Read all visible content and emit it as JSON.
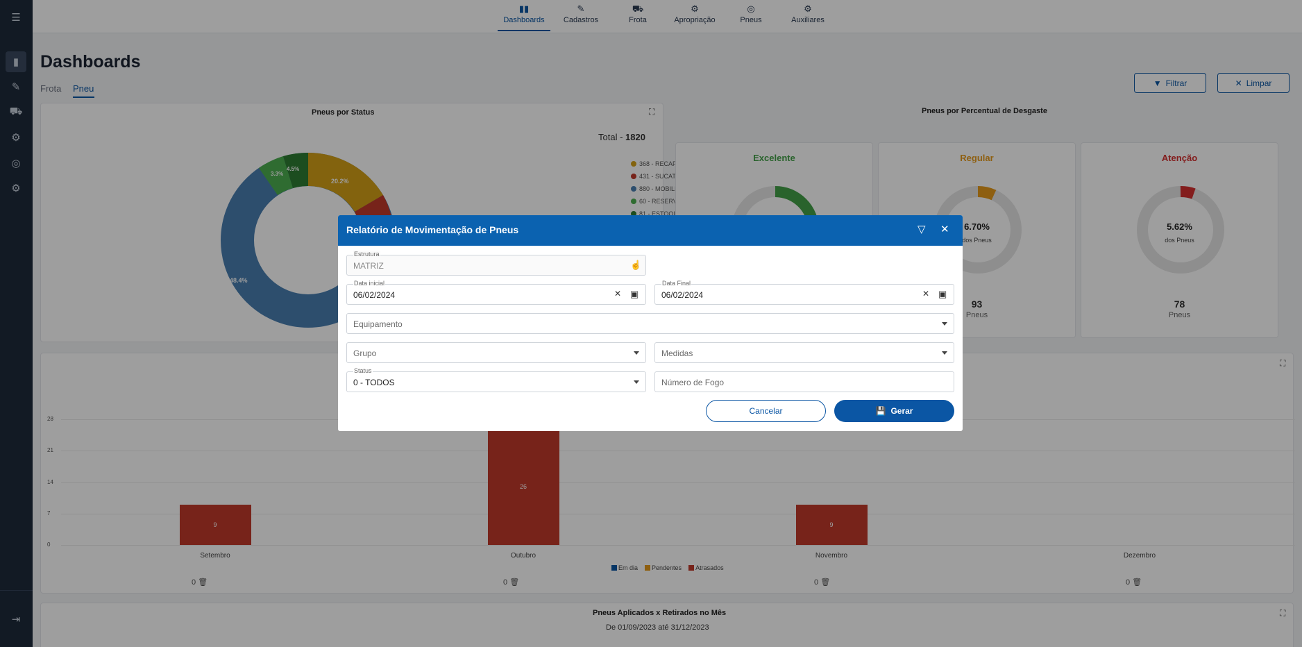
{
  "nav": {
    "items": [
      {
        "label": "Dashboards",
        "icon": "bar-chart-icon",
        "glyph": "▮▮"
      },
      {
        "label": "Cadastros",
        "icon": "pencil-icon",
        "glyph": "✎"
      },
      {
        "label": "Frota",
        "icon": "truck-icon",
        "glyph": "⛟"
      },
      {
        "label": "Apropriação",
        "icon": "gear-tool-icon",
        "glyph": "⚙"
      },
      {
        "label": "Pneus",
        "icon": "tire-icon",
        "glyph": "◎"
      },
      {
        "label": "Auxiliares",
        "icon": "gear-icon",
        "glyph": "⚙"
      }
    ],
    "active": "Dashboards"
  },
  "page": {
    "title": "Dashboards",
    "tabs": [
      "Frota",
      "Pneu"
    ],
    "active_tab": "Pneu",
    "filter_label": "Filtrar",
    "clear_label": "Limpar"
  },
  "status_card": {
    "title": "Pneus por Status",
    "total_label": "Total - ",
    "total_value": "1820",
    "legend": [
      {
        "label": "368 - RECAPAGEM",
        "color": "#d4a017"
      },
      {
        "label": "431 - SUCATEADO",
        "color": "#c0392b"
      },
      {
        "label": "880 - MOBILIZADO",
        "color": "#4a7fb0"
      },
      {
        "label": "60 - RESERVA",
        "color": "#4caf50"
      },
      {
        "label": "81 - ESTOQUE",
        "color": "#2e7d32"
      }
    ],
    "slice_labels": [
      "20.2%",
      "48.4%",
      "3.3%",
      "4.5%"
    ]
  },
  "wear_card": {
    "title": "Pneus por Percentual de Desgaste",
    "items": [
      {
        "status": "Excelente",
        "color": "#43a047",
        "percent": "",
        "percent_label": "",
        "count": "",
        "count_label": ""
      },
      {
        "status": "Regular",
        "color": "#e69a1a",
        "percent": "6.70%",
        "percent_label": "dos Pneus",
        "count": "93",
        "count_label": "Pneus"
      },
      {
        "status": "Atenção",
        "color": "#d32f2f",
        "percent": "5.62%",
        "percent_label": "dos Pneus",
        "count": "78",
        "count_label": "Pneus"
      }
    ]
  },
  "chart_data": {
    "type": "bar",
    "categories": [
      "Setembro",
      "Outubro",
      "Novembro",
      "Dezembro"
    ],
    "series": [
      {
        "name": "Em dia",
        "color": "#0b56a4",
        "values": [
          0,
          0,
          0,
          0
        ]
      },
      {
        "name": "Pendentes",
        "color": "#e69a1a",
        "values": [
          0,
          0,
          0,
          0
        ]
      },
      {
        "name": "Atrasados",
        "color": "#c0392b",
        "values": [
          9,
          26,
          9,
          0
        ]
      }
    ],
    "y_ticks": [
      "0",
      "7",
      "14",
      "21",
      "28"
    ],
    "ylim": [
      0,
      28
    ],
    "legend_position": "bottom",
    "footer_counts": [
      "0",
      "0",
      "0",
      "0"
    ]
  },
  "applied_card": {
    "title": "Pneus Aplicados x Retirados no Mês",
    "subtitle": "De 01/09/2023 até 31/12/2023"
  },
  "modal": {
    "title": "Relatório de Movimentação de Pneus",
    "estrutura": {
      "label": "Estrutura",
      "value": "MATRIZ"
    },
    "data_inicial": {
      "label": "Data inicial",
      "value": "06/02/2024"
    },
    "data_final": {
      "label": "Data Final",
      "value": "06/02/2024"
    },
    "equipamento": {
      "placeholder": "Equipamento"
    },
    "grupo": {
      "placeholder": "Grupo"
    },
    "medidas": {
      "placeholder": "Medidas"
    },
    "status": {
      "label": "Status",
      "value": "0 - TODOS"
    },
    "numero_fogo": {
      "placeholder": "Número de Fogo"
    },
    "cancel_label": "Cancelar",
    "submit_label": "Gerar"
  }
}
